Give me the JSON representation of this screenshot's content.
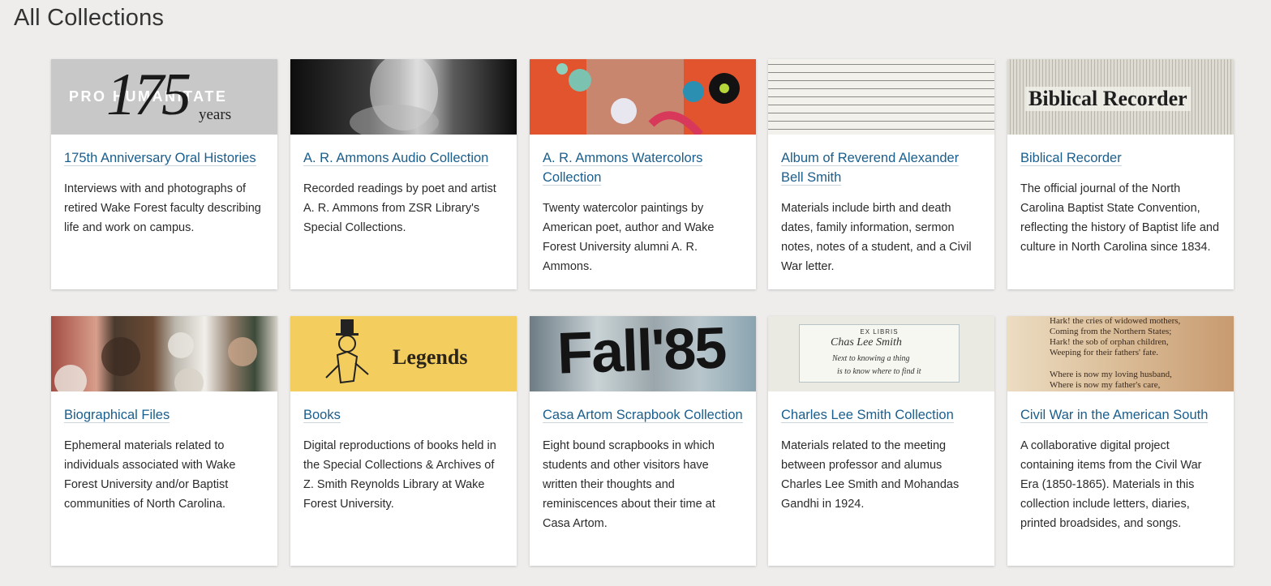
{
  "page": {
    "title": "All Collections"
  },
  "colors": {
    "background": "#eeedec",
    "link": "#1a5e8c",
    "card": "#ffffff"
  },
  "collections": [
    {
      "title": "175th Anniversary Oral Histories",
      "description": "Interviews with and photographs of retired Wake Forest faculty describing life and work on campus.",
      "image_text": {
        "pro": "PRO HUMANITATE",
        "number": "175",
        "suffix": "years"
      }
    },
    {
      "title": "A. R. Ammons Audio Collection",
      "description": "Recorded readings by poet and artist A. R. Ammons from ZSR Library's Special Collections."
    },
    {
      "title": "A. R. Ammons Watercolors Collection",
      "description": "Twenty watercolor paintings by American poet, author and Wake Forest University alumni A. R. Ammons."
    },
    {
      "title": "Album of Reverend Alexander Bell Smith",
      "description": "Materials include birth and death dates, family information, sermon notes, notes of a student, and a Civil War letter."
    },
    {
      "title": "Biblical Recorder",
      "description": "The official journal of the North Carolina Baptist State Convention, reflecting the history of Baptist life and culture in North Carolina since 1834.",
      "image_text": {
        "masthead": "Biblical Recorder"
      }
    },
    {
      "title": "Biographical Files",
      "description": "Ephemeral materials related to individuals associated with Wake Forest University and/or Baptist communities of North Carolina."
    },
    {
      "title": "Books",
      "description": "Digital reproductions of books held in the Special Collections & Archives of Z. Smith Reynolds Library at Wake Forest University.",
      "image_text": {
        "word": "Legends"
      }
    },
    {
      "title": "Casa Artom Scrapbook Collection",
      "description": "Eight bound scrapbooks in which students and other visitors have written their thoughts and reminiscences about their time at Casa Artom.",
      "image_text": {
        "word": "Fall'85"
      }
    },
    {
      "title": "Charles Lee Smith Collection",
      "description": "Materials related to the meeting between professor and alumus Charles Lee Smith and Mohandas Gandhi in 1924.",
      "image_text": {
        "ex_libris": "EX LIBRIS",
        "signature": "Chas Lee Smith",
        "quote_1": "Next to knowing a thing",
        "quote_2": "is to know where to find it"
      }
    },
    {
      "title": "Civil War in the American South",
      "description": "A collaborative digital project containing items from the Civil War Era (1850-1865). Materials in this collection include letters, diaries, printed broadsides, and songs.",
      "image_text": {
        "lines": [
          "Hark! the cries of widowed mothers,",
          "Coming from the Northern States;",
          "Hark! the sob of orphan children,",
          "Weeping for their fathers' fate.",
          "Where is now my loving husband,",
          "Where is now my father's care,"
        ]
      }
    }
  ]
}
